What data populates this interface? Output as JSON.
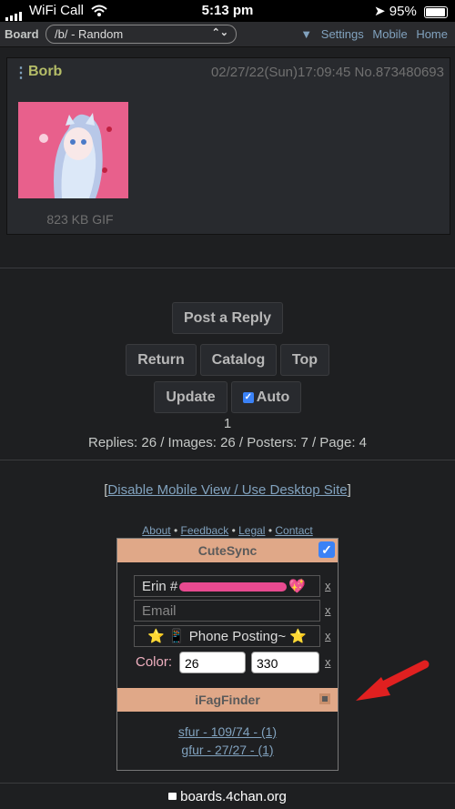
{
  "status_bar": {
    "carrier": "WiFi Call",
    "time": "5:13 pm",
    "battery": "95%"
  },
  "board_bar": {
    "label": "Board",
    "select_value": "/b/ - Random",
    "links": [
      "▼",
      "Settings",
      "Mobile",
      "Home"
    ]
  },
  "post": {
    "menu": "⋮",
    "name": "Borb",
    "meta": "02/27/22(Sun)17:09:45 No.873480693",
    "file_size": "823 KB GIF"
  },
  "buttons": {
    "reply": "Post a Reply",
    "return": "Return",
    "catalog": "Catalog",
    "top": "Top",
    "update": "Update",
    "auto": "Auto"
  },
  "thread_stats": {
    "count": "1",
    "summary": "Replies: 26 / Images: 26 / Posters: 7 / Page: 4"
  },
  "mobile_link": {
    "open": "[",
    "text": "Disable Mobile View / Use Desktop Site",
    "close": "]"
  },
  "footer_links": [
    "About",
    "Feedback",
    "Legal",
    "Contact"
  ],
  "footer_sep": "•",
  "cutesync": {
    "title": "CuteSync",
    "name_value": "Erin #",
    "name_emoji": "💖",
    "email_placeholder": "Email",
    "subject_value": "⭐ 📱 Phone Posting~ ⭐",
    "x_label": "x",
    "color_label": "Color:",
    "color_a": "26",
    "color_b": "330",
    "finder_title": "iFagFinder",
    "finder_items": [
      "sfur - 109/74 - (1)",
      "gfur - 27/27 - (1)"
    ]
  },
  "url_bar": {
    "domain": "boards.4chan.org"
  },
  "colors": {
    "accent": "#81a2be",
    "name": "#b5bd68",
    "panel_header": "#e0a888",
    "annotation_arrow": "#e02020"
  }
}
